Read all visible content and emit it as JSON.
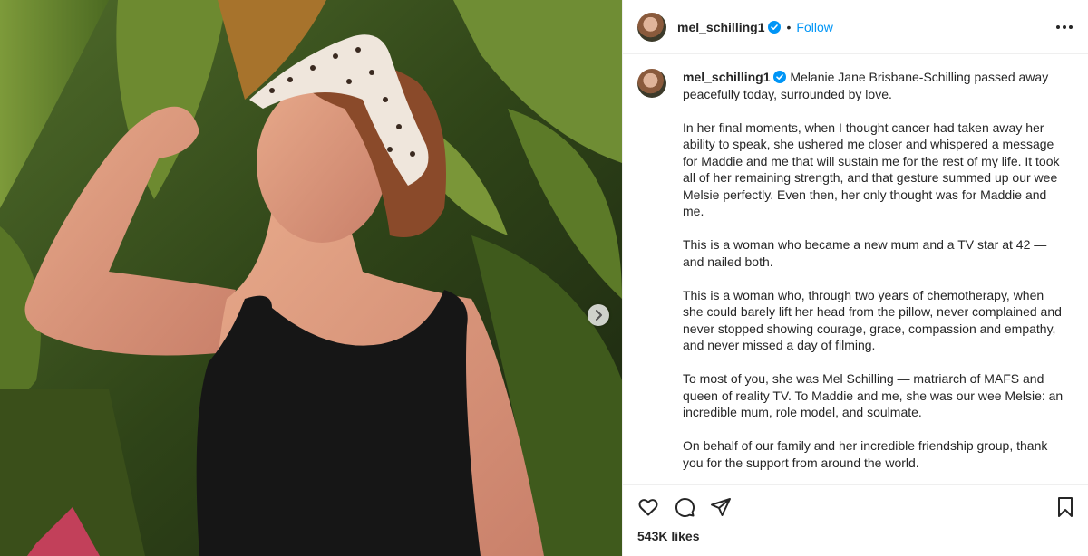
{
  "post": {
    "username": "mel_schilling1",
    "follow_label": "Follow",
    "separator": "•",
    "likes": "543K likes"
  },
  "caption": {
    "username": "mel_schilling1",
    "first_line": " Melanie Jane Brisbane-Schilling passed away peacefully today, surrounded by love.",
    "paragraphs": [
      "In her final moments, when I thought cancer had taken away her ability to speak, she ushered me closer and whispered a message for Maddie and me that will sustain me for the rest of my life. It took all of her remaining strength, and that gesture summed up our wee Melsie perfectly. Even then, her only thought was for Maddie and me.",
      "This is a woman who became a new mum and a TV star at 42 — and nailed both.",
      "This is a woman who, through two years of chemotherapy, when she could barely lift her head from the pillow, never complained and never stopped showing courage, grace, compassion and empathy, and never missed a day of filming.",
      "To most of you, she was Mel Schilling — matriarch of MAFS and queen of reality TV. To Maddie and me, she was our wee Melsie: an incredible mum, role model, and soulmate.",
      "On behalf of our family and her incredible friendship group, thank you for the support from around the world."
    ]
  },
  "icons": {
    "verified": "verified-badge-icon",
    "more": "more-options-icon",
    "like": "heart-icon",
    "comment": "comment-icon",
    "share": "share-icon",
    "save": "bookmark-icon",
    "next": "chevron-right-icon"
  },
  "colors": {
    "follow": "#0095f6",
    "verified": "#0095f6",
    "text": "#262626"
  }
}
